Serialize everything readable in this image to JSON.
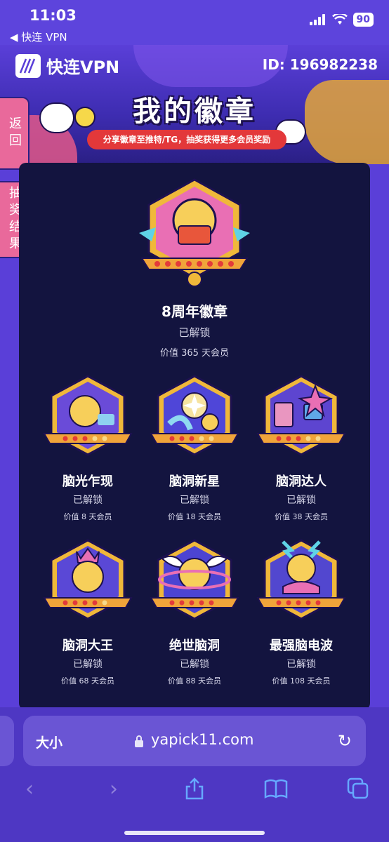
{
  "status_bar": {
    "time": "11:03",
    "back_app": "◀ 快连 VPN",
    "battery": "90"
  },
  "header": {
    "logo_text": "快连VPN",
    "user_id": "ID: 196982238",
    "title": "我的徽章",
    "subtitle": "分享徽章至推特/TG，抽奖获得更多会员奖励"
  },
  "side_tabs": {
    "back": "返回",
    "results": "抽奖结果"
  },
  "badges": [
    {
      "name": "8周年徽章",
      "status": "已解锁",
      "value": "价值 365 天会员",
      "color": "#e96fb4",
      "stars": 8
    },
    {
      "name": "脑光乍现",
      "status": "已解锁",
      "value": "价值 8 天会员",
      "color": "#6a4bd8",
      "stars": 3
    },
    {
      "name": "脑洞新星",
      "status": "已解锁",
      "value": "价值 18 天会员",
      "color": "#4f46d8",
      "stars": 3
    },
    {
      "name": "脑洞达人",
      "status": "已解锁",
      "value": "价值 38 天会员",
      "color": "#5d45d0",
      "stars": 3
    },
    {
      "name": "脑洞大王",
      "status": "已解锁",
      "value": "价值 68 天会员",
      "color": "#5a48d6",
      "stars": 4
    },
    {
      "name": "绝世脑洞",
      "status": "已解锁",
      "value": "价值 88 天会员",
      "color": "#4c44d2",
      "stars": 5
    },
    {
      "name": "最强脑电波",
      "status": "已解锁",
      "value": "价值 108 天会员",
      "color": "#5247cf",
      "stars": 5
    }
  ],
  "browser": {
    "text_size": "大小",
    "url": "yapick11.com"
  }
}
